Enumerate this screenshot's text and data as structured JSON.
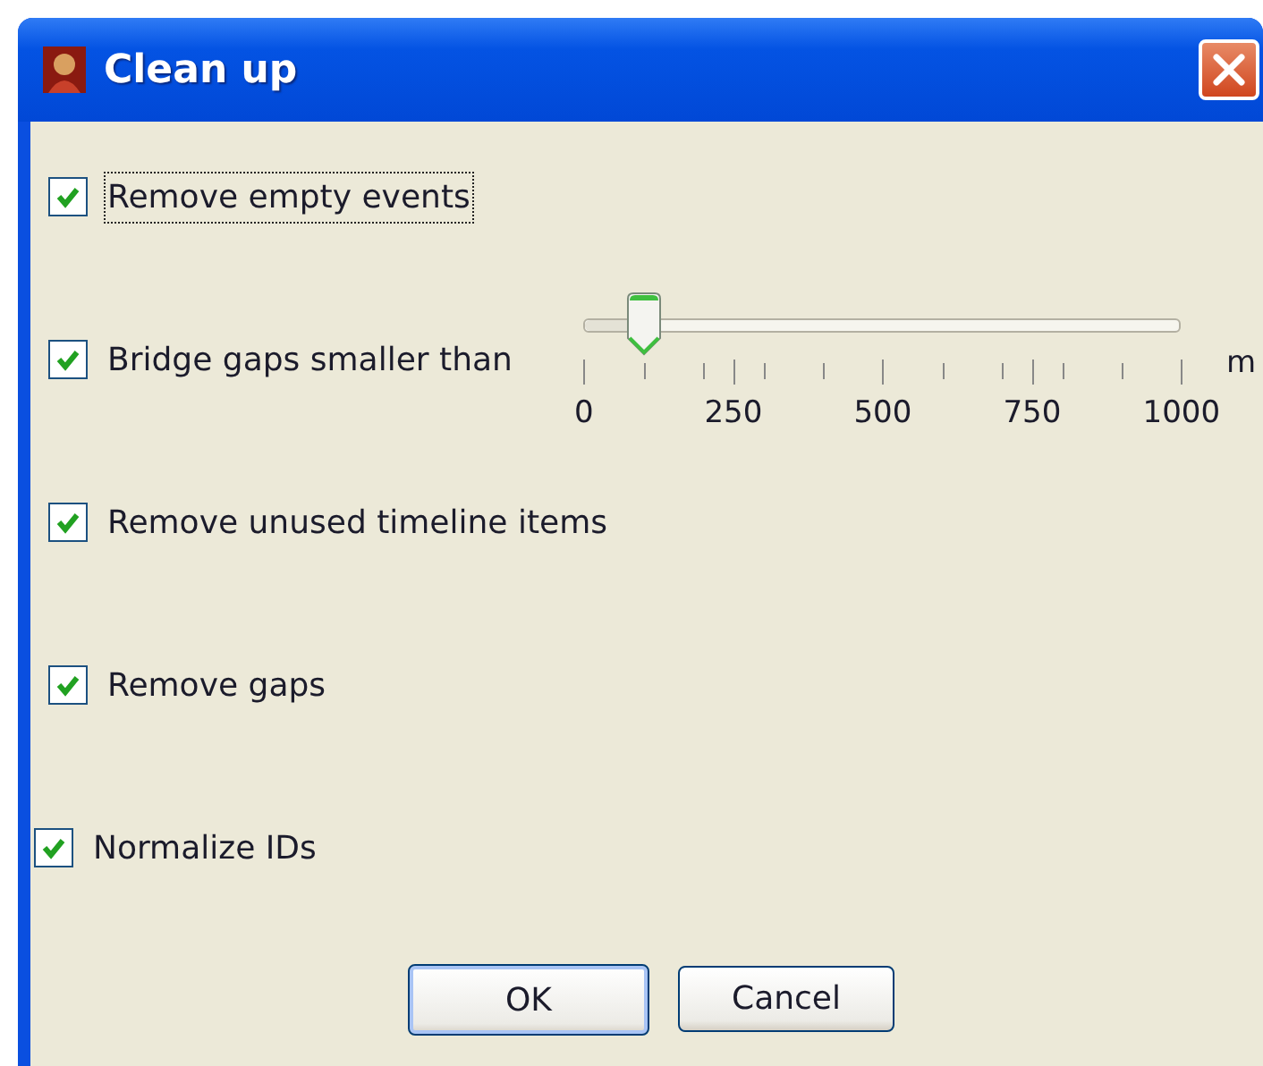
{
  "window": {
    "title": "Clean up"
  },
  "options": [
    {
      "kind": "checkbox",
      "label": "Remove empty events",
      "checked": true,
      "focused": true
    },
    {
      "kind": "slider",
      "label": "Bridge gaps smaller than",
      "checked": true,
      "focused": false,
      "slider": {
        "level": 0.1,
        "tick_labels": [
          "0",
          "250",
          "500",
          "750",
          "1000"
        ],
        "unit": "m"
      }
    },
    {
      "kind": "checkbox",
      "label": "Remove unused timeline items",
      "checked": true,
      "focused": false
    },
    {
      "kind": "checkbox",
      "label": "Remove gaps",
      "checked": true,
      "focused": false
    },
    {
      "kind": "checkbox",
      "label": "Normalize IDs",
      "checked": true,
      "focused": false
    }
  ],
  "buttons": [
    {
      "label": "OK",
      "default": true
    },
    {
      "label": "Cancel",
      "default": false
    }
  ]
}
